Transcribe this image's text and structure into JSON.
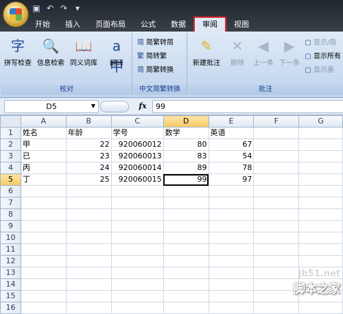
{
  "tabs": [
    "开始",
    "插入",
    "页面布局",
    "公式",
    "数据",
    "审阅",
    "视图"
  ],
  "active_tab": "审阅",
  "ribbon": {
    "proofing": {
      "label": "校对",
      "buttons": [
        "拼写检查",
        "信息检索",
        "同义词库",
        "翻译"
      ]
    },
    "chinese_conversion": {
      "label": "中文简繁转换",
      "buttons": [
        "简繁转简",
        "简转繁",
        "简繁转换"
      ]
    },
    "comments": {
      "label": "批注",
      "new_comment": "新建批注",
      "delete": "删除",
      "previous": "上一条",
      "next": "下一条",
      "side_items": [
        "显示/隐",
        "显示所有",
        "显示墨"
      ]
    }
  },
  "formula_bar": {
    "name_box": "D5",
    "fx_label": "fx",
    "formula": "99"
  },
  "grid": {
    "columns": [
      "A",
      "B",
      "C",
      "D",
      "E",
      "F",
      "G"
    ],
    "selected_column": "D",
    "selected_row": "5",
    "row_numbers": [
      "1",
      "2",
      "3",
      "4",
      "5",
      "6",
      "7",
      "8",
      "9",
      "10",
      "11",
      "12",
      "13",
      "14",
      "15",
      "16"
    ],
    "rows": [
      [
        "姓名",
        "年龄",
        "学号",
        "数学",
        "英语",
        "",
        ""
      ],
      [
        "甲",
        "22",
        "920060012",
        "80",
        "67",
        "",
        ""
      ],
      [
        "已",
        "23",
        "920060013",
        "83",
        "54",
        "",
        ""
      ],
      [
        "丙",
        "24",
        "920060014",
        "89",
        "78",
        "",
        ""
      ],
      [
        "丁",
        "25",
        "920060015",
        "99",
        "97",
        "",
        ""
      ],
      [
        "",
        "",
        "",
        "",
        "",
        "",
        ""
      ],
      [
        "",
        "",
        "",
        "",
        "",
        "",
        ""
      ],
      [
        "",
        "",
        "",
        "",
        "",
        "",
        ""
      ],
      [
        "",
        "",
        "",
        "",
        "",
        "",
        ""
      ],
      [
        "",
        "",
        "",
        "",
        "",
        "",
        ""
      ],
      [
        "",
        "",
        "",
        "",
        "",
        "",
        ""
      ],
      [
        "",
        "",
        "",
        "",
        "",
        "",
        ""
      ],
      [
        "",
        "",
        "",
        "",
        "",
        "",
        ""
      ],
      [
        "",
        "",
        "",
        "",
        "",
        "",
        ""
      ],
      [
        "",
        "",
        "",
        "",
        "",
        "",
        ""
      ],
      [
        "",
        "",
        "",
        "",
        "",
        "",
        ""
      ]
    ]
  },
  "watermark": {
    "site": "jb51.net",
    "brand": "脚本之家"
  },
  "colors": {
    "tab_bar": "#2b3139",
    "ribbon": "#d6e3f5",
    "active_tab_highlight": "#d9262c",
    "selected_header": "#f8c965"
  }
}
